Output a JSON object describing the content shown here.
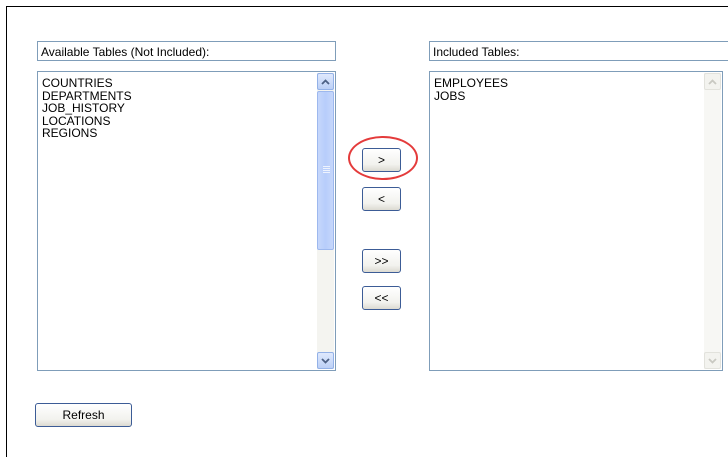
{
  "available": {
    "header": "Available Tables (Not Included):",
    "items": [
      "COUNTRIES",
      "DEPARTMENTS",
      "JOB_HISTORY",
      "LOCATIONS",
      "REGIONS"
    ]
  },
  "included": {
    "header": "Included Tables:",
    "items": [
      "EMPLOYEES",
      "JOBS"
    ]
  },
  "buttons": {
    "add_one": ">",
    "remove_one": "<",
    "add_all": ">>",
    "remove_all": "<<",
    "refresh": "Refresh"
  },
  "colors": {
    "highlight": "#e43b3b",
    "field_border": "#7f9db9",
    "button_border": "#3c5c96"
  },
  "icons": {
    "scroll_up": "chevron-up-icon",
    "scroll_down": "chevron-down-icon"
  }
}
